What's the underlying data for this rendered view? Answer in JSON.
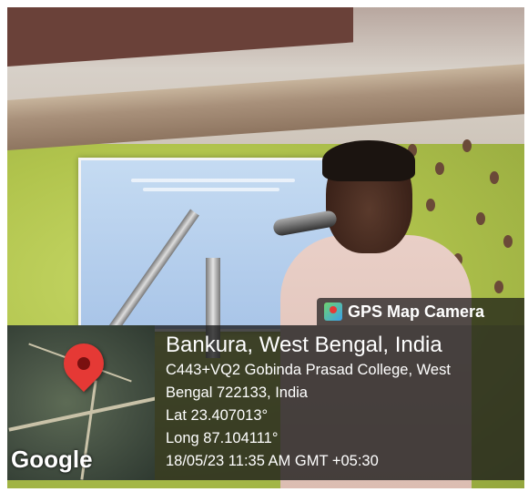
{
  "overlay": {
    "app_name": "GPS Map Camera",
    "app_icon": "gps-map-camera-icon",
    "location_title": "Bankura, West Bengal, India",
    "address_line_1": "C443+VQ2 Gobinda Prasad College, West",
    "address_line_2": "Bengal 722133, India",
    "latitude": "Lat 23.407013°",
    "longitude": "Long 87.104111°",
    "timestamp": "18/05/23 11:35 AM GMT +05:30",
    "map_attribution": "Google",
    "pin_color": "#e53935"
  }
}
